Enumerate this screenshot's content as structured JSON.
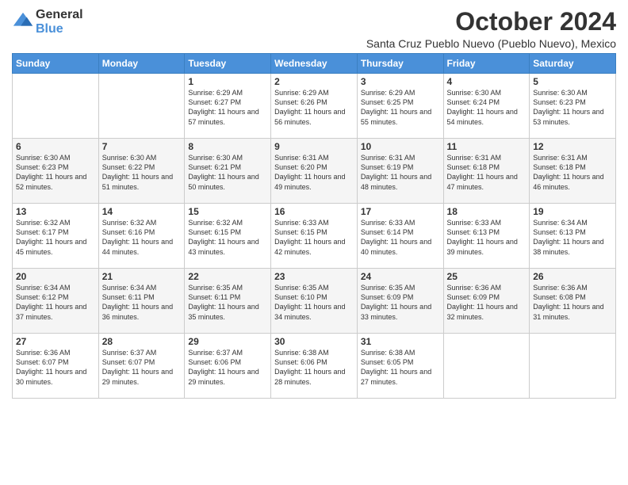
{
  "header": {
    "logo_general": "General",
    "logo_blue": "Blue",
    "month_title": "October 2024",
    "location": "Santa Cruz Pueblo Nuevo (Pueblo Nuevo), Mexico"
  },
  "weekdays": [
    "Sunday",
    "Monday",
    "Tuesday",
    "Wednesday",
    "Thursday",
    "Friday",
    "Saturday"
  ],
  "weeks": [
    [
      {
        "day": "",
        "sunrise": "",
        "sunset": "",
        "daylight": ""
      },
      {
        "day": "",
        "sunrise": "",
        "sunset": "",
        "daylight": ""
      },
      {
        "day": "1",
        "sunrise": "Sunrise: 6:29 AM",
        "sunset": "Sunset: 6:27 PM",
        "daylight": "Daylight: 11 hours and 57 minutes."
      },
      {
        "day": "2",
        "sunrise": "Sunrise: 6:29 AM",
        "sunset": "Sunset: 6:26 PM",
        "daylight": "Daylight: 11 hours and 56 minutes."
      },
      {
        "day": "3",
        "sunrise": "Sunrise: 6:29 AM",
        "sunset": "Sunset: 6:25 PM",
        "daylight": "Daylight: 11 hours and 55 minutes."
      },
      {
        "day": "4",
        "sunrise": "Sunrise: 6:30 AM",
        "sunset": "Sunset: 6:24 PM",
        "daylight": "Daylight: 11 hours and 54 minutes."
      },
      {
        "day": "5",
        "sunrise": "Sunrise: 6:30 AM",
        "sunset": "Sunset: 6:23 PM",
        "daylight": "Daylight: 11 hours and 53 minutes."
      }
    ],
    [
      {
        "day": "6",
        "sunrise": "Sunrise: 6:30 AM",
        "sunset": "Sunset: 6:23 PM",
        "daylight": "Daylight: 11 hours and 52 minutes."
      },
      {
        "day": "7",
        "sunrise": "Sunrise: 6:30 AM",
        "sunset": "Sunset: 6:22 PM",
        "daylight": "Daylight: 11 hours and 51 minutes."
      },
      {
        "day": "8",
        "sunrise": "Sunrise: 6:30 AM",
        "sunset": "Sunset: 6:21 PM",
        "daylight": "Daylight: 11 hours and 50 minutes."
      },
      {
        "day": "9",
        "sunrise": "Sunrise: 6:31 AM",
        "sunset": "Sunset: 6:20 PM",
        "daylight": "Daylight: 11 hours and 49 minutes."
      },
      {
        "day": "10",
        "sunrise": "Sunrise: 6:31 AM",
        "sunset": "Sunset: 6:19 PM",
        "daylight": "Daylight: 11 hours and 48 minutes."
      },
      {
        "day": "11",
        "sunrise": "Sunrise: 6:31 AM",
        "sunset": "Sunset: 6:18 PM",
        "daylight": "Daylight: 11 hours and 47 minutes."
      },
      {
        "day": "12",
        "sunrise": "Sunrise: 6:31 AM",
        "sunset": "Sunset: 6:18 PM",
        "daylight": "Daylight: 11 hours and 46 minutes."
      }
    ],
    [
      {
        "day": "13",
        "sunrise": "Sunrise: 6:32 AM",
        "sunset": "Sunset: 6:17 PM",
        "daylight": "Daylight: 11 hours and 45 minutes."
      },
      {
        "day": "14",
        "sunrise": "Sunrise: 6:32 AM",
        "sunset": "Sunset: 6:16 PM",
        "daylight": "Daylight: 11 hours and 44 minutes."
      },
      {
        "day": "15",
        "sunrise": "Sunrise: 6:32 AM",
        "sunset": "Sunset: 6:15 PM",
        "daylight": "Daylight: 11 hours and 43 minutes."
      },
      {
        "day": "16",
        "sunrise": "Sunrise: 6:33 AM",
        "sunset": "Sunset: 6:15 PM",
        "daylight": "Daylight: 11 hours and 42 minutes."
      },
      {
        "day": "17",
        "sunrise": "Sunrise: 6:33 AM",
        "sunset": "Sunset: 6:14 PM",
        "daylight": "Daylight: 11 hours and 40 minutes."
      },
      {
        "day": "18",
        "sunrise": "Sunrise: 6:33 AM",
        "sunset": "Sunset: 6:13 PM",
        "daylight": "Daylight: 11 hours and 39 minutes."
      },
      {
        "day": "19",
        "sunrise": "Sunrise: 6:34 AM",
        "sunset": "Sunset: 6:13 PM",
        "daylight": "Daylight: 11 hours and 38 minutes."
      }
    ],
    [
      {
        "day": "20",
        "sunrise": "Sunrise: 6:34 AM",
        "sunset": "Sunset: 6:12 PM",
        "daylight": "Daylight: 11 hours and 37 minutes."
      },
      {
        "day": "21",
        "sunrise": "Sunrise: 6:34 AM",
        "sunset": "Sunset: 6:11 PM",
        "daylight": "Daylight: 11 hours and 36 minutes."
      },
      {
        "day": "22",
        "sunrise": "Sunrise: 6:35 AM",
        "sunset": "Sunset: 6:11 PM",
        "daylight": "Daylight: 11 hours and 35 minutes."
      },
      {
        "day": "23",
        "sunrise": "Sunrise: 6:35 AM",
        "sunset": "Sunset: 6:10 PM",
        "daylight": "Daylight: 11 hours and 34 minutes."
      },
      {
        "day": "24",
        "sunrise": "Sunrise: 6:35 AM",
        "sunset": "Sunset: 6:09 PM",
        "daylight": "Daylight: 11 hours and 33 minutes."
      },
      {
        "day": "25",
        "sunrise": "Sunrise: 6:36 AM",
        "sunset": "Sunset: 6:09 PM",
        "daylight": "Daylight: 11 hours and 32 minutes."
      },
      {
        "day": "26",
        "sunrise": "Sunrise: 6:36 AM",
        "sunset": "Sunset: 6:08 PM",
        "daylight": "Daylight: 11 hours and 31 minutes."
      }
    ],
    [
      {
        "day": "27",
        "sunrise": "Sunrise: 6:36 AM",
        "sunset": "Sunset: 6:07 PM",
        "daylight": "Daylight: 11 hours and 30 minutes."
      },
      {
        "day": "28",
        "sunrise": "Sunrise: 6:37 AM",
        "sunset": "Sunset: 6:07 PM",
        "daylight": "Daylight: 11 hours and 29 minutes."
      },
      {
        "day": "29",
        "sunrise": "Sunrise: 6:37 AM",
        "sunset": "Sunset: 6:06 PM",
        "daylight": "Daylight: 11 hours and 29 minutes."
      },
      {
        "day": "30",
        "sunrise": "Sunrise: 6:38 AM",
        "sunset": "Sunset: 6:06 PM",
        "daylight": "Daylight: 11 hours and 28 minutes."
      },
      {
        "day": "31",
        "sunrise": "Sunrise: 6:38 AM",
        "sunset": "Sunset: 6:05 PM",
        "daylight": "Daylight: 11 hours and 27 minutes."
      },
      {
        "day": "",
        "sunrise": "",
        "sunset": "",
        "daylight": ""
      },
      {
        "day": "",
        "sunrise": "",
        "sunset": "",
        "daylight": ""
      }
    ]
  ]
}
